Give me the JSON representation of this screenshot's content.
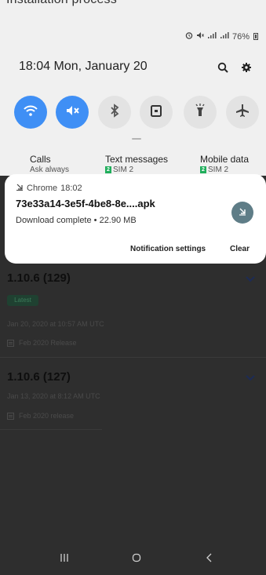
{
  "statusbar": {
    "cut_text": "Installation process",
    "battery_text": "76%"
  },
  "quick_panel": {
    "time_date": "18:04  Mon, January 20",
    "tiles": [
      {
        "name": "wifi",
        "on": true
      },
      {
        "name": "mute",
        "on": true
      },
      {
        "name": "bluetooth",
        "on": false
      },
      {
        "name": "lock",
        "on": false
      },
      {
        "name": "flashlight",
        "on": false
      },
      {
        "name": "airplane",
        "on": false
      }
    ],
    "sim": {
      "calls_label": "Calls",
      "calls_value": "Ask always",
      "text_label": "Text messages",
      "text_value": "SIM 2",
      "data_label": "Mobile data",
      "data_value": "SIM 2",
      "badge": "2"
    }
  },
  "notification": {
    "app": "Chrome",
    "time": "18:02",
    "title": "73e33a14-3e5f-4be8-8e....apk",
    "subtitle": "Download complete • 22.90 MB",
    "actions": {
      "settings": "Notification settings",
      "clear": "Clear"
    }
  },
  "background_content": {
    "releases": [
      {
        "title": "1.10.6 (129)",
        "badge": "Latest",
        "date": "Jan 20, 2020 at 10:57 AM UTC",
        "note": "Feb 2020 Release"
      },
      {
        "title": "1.10.6 (127)",
        "date": "Jan 13, 2020 at 8:12 AM UTC",
        "note": "Feb 2020 release"
      }
    ]
  },
  "colors": {
    "accent": "#3f8ff5",
    "panel_bg": "#f0f0f0",
    "dim_bg": "#2e2e2e",
    "sim_green": "#1fae5b"
  }
}
